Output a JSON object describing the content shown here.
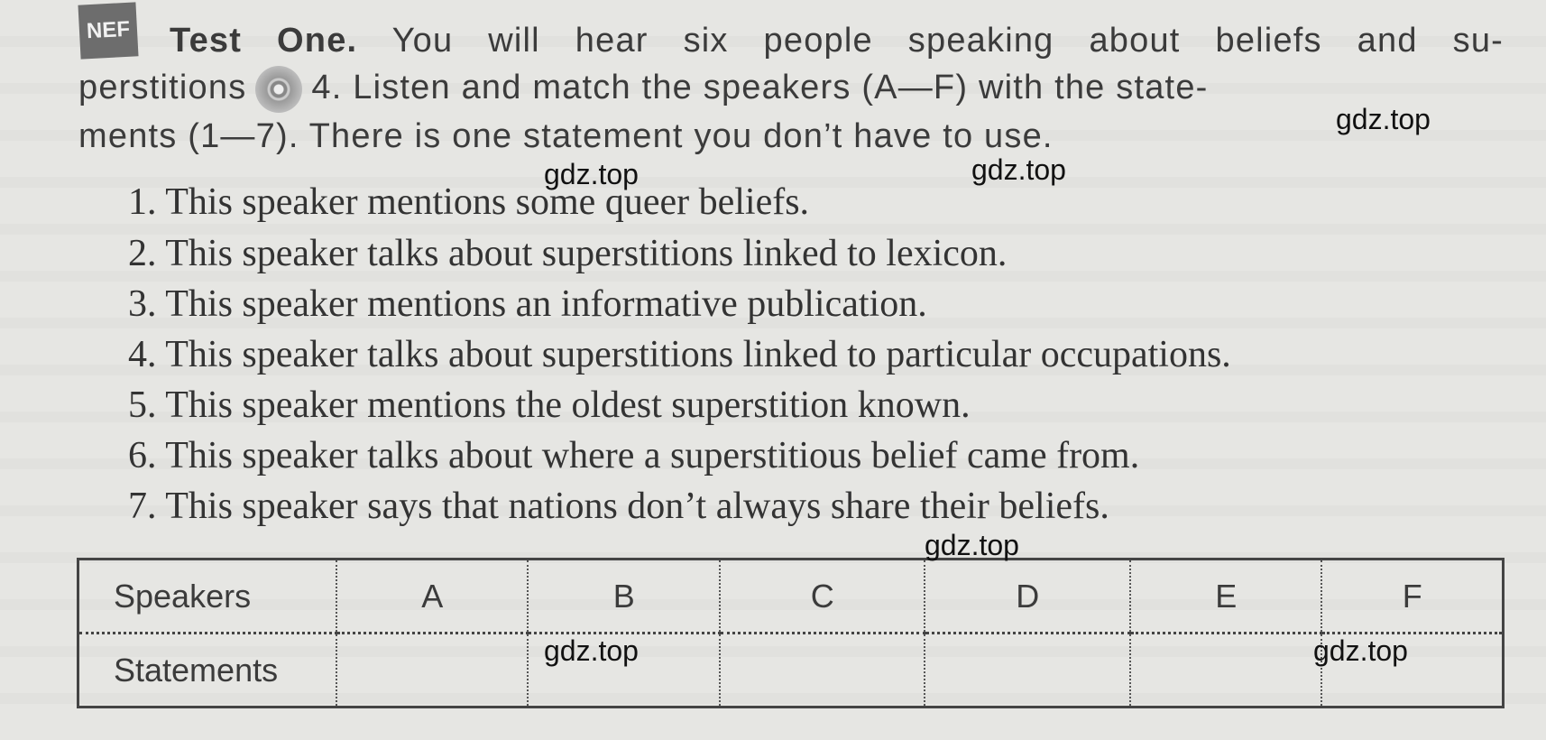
{
  "header": {
    "badge": "NEF",
    "title_bold": "Test One.",
    "line1_rest": "You will hear six people speaking about beliefs and su-",
    "line2_a": "perstitions",
    "line2_b": "4. Listen and match the speakers (A—F) with the state-",
    "line3": "ments (1—7). There is one statement you don’t have to use.",
    "icons": [
      "nef-badge-icon",
      "cd-icon"
    ]
  },
  "statements": [
    "1. This speaker mentions some queer beliefs.",
    "2. This speaker talks about superstitions linked to lexicon.",
    "3. This speaker mentions an informative publication.",
    "4. This speaker talks about superstitions linked to particular occupations.",
    "5. This speaker mentions the oldest superstition known.",
    "6. This speaker talks about where a superstitious belief came from.",
    "7. This speaker says that nations don’t always share their beliefs."
  ],
  "table": {
    "row_headers": [
      "Speakers",
      "Statements"
    ],
    "speakers": [
      "A",
      "B",
      "C",
      "D",
      "E",
      "F"
    ]
  },
  "watermarks": [
    "gdz.top",
    "gdz.top",
    "gdz.top",
    "gdz.top",
    "gdz.top",
    "gdz.top"
  ]
}
